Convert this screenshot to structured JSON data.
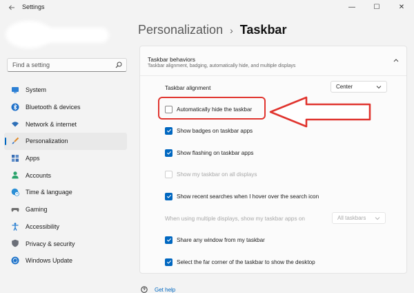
{
  "window": {
    "title": "Settings",
    "controls": [
      "—",
      "☐",
      "✕"
    ]
  },
  "search": {
    "placeholder": "Find a setting"
  },
  "sidebar": {
    "items": [
      {
        "label": "System",
        "icon": "monitor-icon",
        "color": "#2b7fd4"
      },
      {
        "label": "Bluetooth & devices",
        "icon": "bluetooth-icon",
        "color": "#1d6fc9"
      },
      {
        "label": "Network & internet",
        "icon": "wifi-icon",
        "color": "#2d6fb7"
      },
      {
        "label": "Personalization",
        "icon": "brush-icon",
        "color": "#e08a2a",
        "active": true
      },
      {
        "label": "Apps",
        "icon": "apps-icon",
        "color": "#3a6fb5"
      },
      {
        "label": "Accounts",
        "icon": "person-icon",
        "color": "#2aa36b"
      },
      {
        "label": "Time & language",
        "icon": "globe-clock-icon",
        "color": "#2b8fd6"
      },
      {
        "label": "Gaming",
        "icon": "gamepad-icon",
        "color": "#6d6d6d"
      },
      {
        "label": "Accessibility",
        "icon": "accessibility-icon",
        "color": "#1f7ad0"
      },
      {
        "label": "Privacy & security",
        "icon": "shield-icon",
        "color": "#6b6f78"
      },
      {
        "label": "Windows Update",
        "icon": "update-icon",
        "color": "#1d72c9"
      }
    ]
  },
  "header": {
    "parent": "Personalization",
    "separator": "›",
    "current": "Taskbar"
  },
  "card": {
    "title": "Taskbar behaviors",
    "subtitle": "Taskbar alignment, badging, automatically hide, and multiple displays"
  },
  "alignment": {
    "label": "Taskbar alignment",
    "value": "Center"
  },
  "options": {
    "auto_hide": {
      "label": "Automatically hide the taskbar",
      "checked": false
    },
    "badges": {
      "label": "Show badges on taskbar apps",
      "checked": true
    },
    "flashing": {
      "label": "Show flashing on taskbar apps",
      "checked": true
    },
    "all_displays": {
      "label": "Show my taskbar on all displays",
      "checked": false,
      "disabled": true
    },
    "recent_searches": {
      "label": "Show recent searches when I hover over the search icon",
      "checked": true
    },
    "share_window": {
      "label": "Share any window from my taskbar",
      "checked": true
    },
    "far_corner": {
      "label": "Select the far corner of the taskbar to show the desktop",
      "checked": true
    }
  },
  "multi_display": {
    "label": "When using multiple displays, show my taskbar apps on",
    "value": "All taskbars"
  },
  "help": {
    "label": "Get help"
  },
  "annotation_color": "#e0342e",
  "accent": "#0067c0"
}
